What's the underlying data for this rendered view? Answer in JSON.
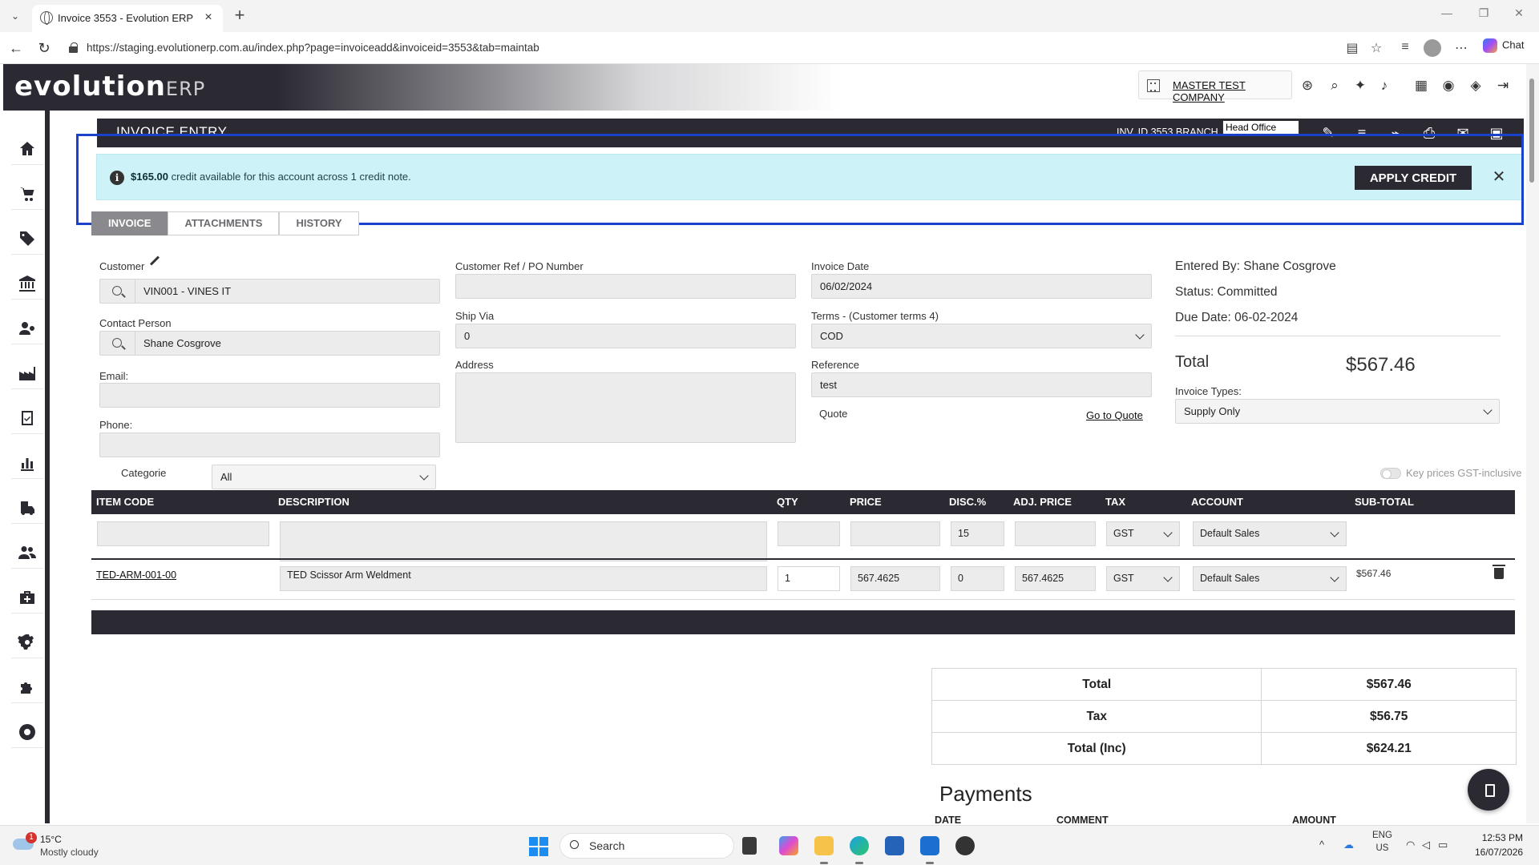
{
  "browser": {
    "tab_title": "Invoice 3553 - Evolution ERP",
    "url": "https://staging.evolutionerp.com.au/index.php?page=invoiceadd&invoiceid=3553&tab=maintab",
    "copilot_label": "Chat"
  },
  "header": {
    "logo_main": "evolution",
    "logo_suffix": "ERP",
    "company": "MASTER TEST COMPANY"
  },
  "entry_bar": {
    "title": "INVOICE ENTRY",
    "inv_branch": "INV. ID 3553 BRANCH",
    "branch_value": "Head Office"
  },
  "credit_banner": {
    "amount": "$165.00",
    "message": "credit available for this account across 1 credit note.",
    "apply_label": "APPLY CREDIT",
    "close_glyph": "✕"
  },
  "tabs": [
    "INVOICE",
    "ATTACHMENTS",
    "HISTORY"
  ],
  "form": {
    "customer_label": "Customer",
    "customer_value": "VIN001 - VINES IT",
    "contact_label": "Contact Person",
    "contact_value": "Shane Cosgrove",
    "email_label": "Email:",
    "email_value": "",
    "phone_label": "Phone:",
    "phone_value": "",
    "categorie_label": "Categorie",
    "categorie_value": "All",
    "custref_label": "Customer Ref / PO Number",
    "custref_value": "",
    "shipvia_label": "Ship Via",
    "shipvia_value": "0",
    "address_label": "Address",
    "address_value": "",
    "invdate_label": "Invoice Date",
    "invdate_value": "06/02/2024",
    "terms_label": "Terms - (Customer terms 4)",
    "terms_value": "COD",
    "reference_label": "Reference",
    "reference_value": "test",
    "quote_label": "Quote",
    "goto_quote": "Go to Quote"
  },
  "summary": {
    "entered_by": "Entered By: Shane Cosgrove",
    "status": "Status: Committed",
    "due_date": "Due Date: 06-02-2024",
    "total_label": "Total",
    "total_value": "$567.46",
    "invoice_types_label": "Invoice Types:",
    "invoice_types_value": "Supply Only",
    "gst_toggle_label": "Key prices GST-inclusive"
  },
  "table": {
    "headers": [
      "ITEM CODE",
      "DESCRIPTION",
      "QTY",
      "PRICE",
      "DISC.%",
      "ADJ. PRICE",
      "TAX",
      "ACCOUNT",
      "SUB-TOTAL"
    ],
    "new_row": {
      "disc": "15",
      "tax": "GST",
      "account": "Default Sales"
    },
    "rows": [
      {
        "item_code": "TED-ARM-001-00",
        "description": "TED Scissor Arm Weldment",
        "qty": "1",
        "price": "567.4625",
        "disc": "0",
        "adj_price": "567.4625",
        "tax": "GST",
        "account": "Default Sales",
        "subtotal": "$567.46"
      }
    ]
  },
  "totals": {
    "total_label": "Total",
    "total_value": "$567.46",
    "tax_label": "Tax",
    "tax_value": "$56.75",
    "inc_label": "Total (Inc)",
    "inc_value": "$624.21"
  },
  "payments": {
    "title": "Payments",
    "cols": [
      "DATE",
      "COMMENT",
      "AMOUNT"
    ]
  },
  "taskbar": {
    "weather_temp": "15°C",
    "weather_desc": "Mostly cloudy",
    "weather_badge": "1",
    "search_label": "Search",
    "lang_top": "ENG",
    "lang_bottom": "US",
    "time": "12:53 PM",
    "date": "16/07/2026"
  },
  "colors": {
    "dark": "#2b2a33",
    "banner": "#cdf3f8",
    "highlight": "#1a41c9"
  }
}
